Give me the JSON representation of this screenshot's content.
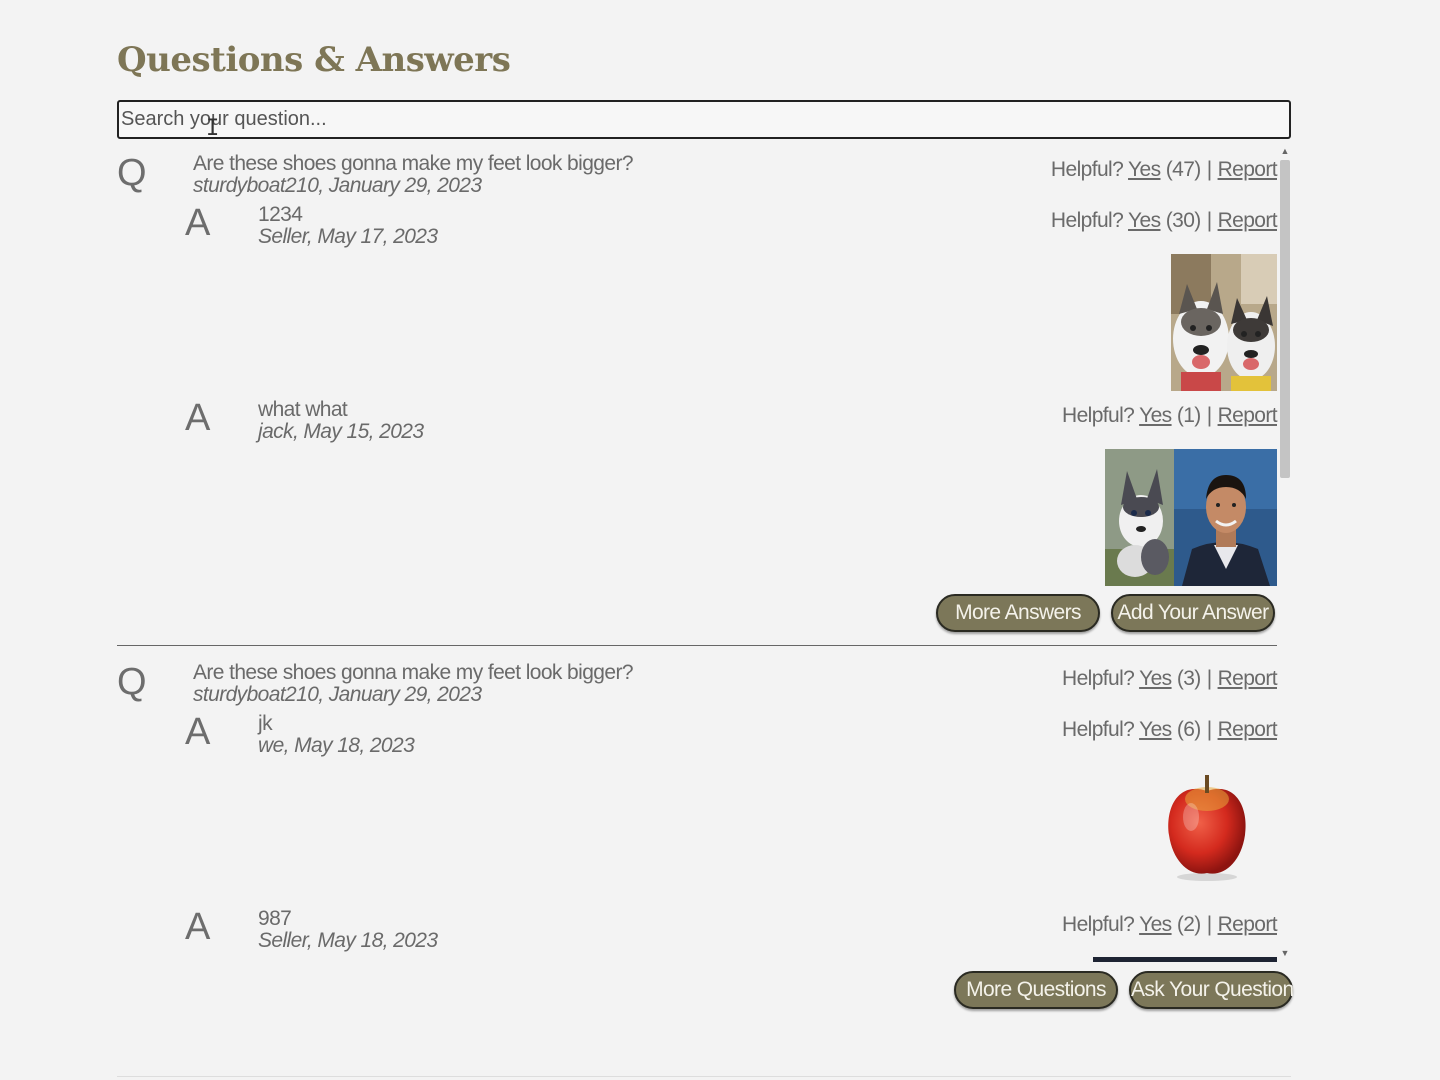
{
  "page": {
    "title": "Questions & Answers"
  },
  "search": {
    "placeholder": "Search your question..."
  },
  "questions": [
    {
      "letter": "Q",
      "text": "Are these shoes gonna make my feet look bigger?",
      "meta": "sturdyboat210, January 29, 2023",
      "helpful_label": "Helpful?",
      "yes_label": "Yes",
      "yes_count": "(47)",
      "report_label": "Report",
      "answers": [
        {
          "letter": "A",
          "text": "1234",
          "meta": "Seller, May 17, 2023",
          "helpful_label": "Helpful?",
          "yes_label": "Yes",
          "yes_count": "(30)",
          "report_label": "Report",
          "photos": [
            "two-huskies-photo"
          ]
        },
        {
          "letter": "A",
          "text": "what what",
          "meta": "jack, May 15, 2023",
          "helpful_label": "Helpful?",
          "yes_label": "Yes",
          "yes_count": "(1)",
          "report_label": "Report",
          "photos": [
            "husky-puppy-photo",
            "man-portrait-photo"
          ]
        }
      ],
      "more_answers_label": "More Answers",
      "add_answer_label": "Add Your Answer"
    },
    {
      "letter": "Q",
      "text": "Are these shoes gonna make my feet look bigger?",
      "meta": "sturdyboat210, January 29, 2023",
      "helpful_label": "Helpful?",
      "yes_label": "Yes",
      "yes_count": "(3)",
      "report_label": "Report",
      "answers": [
        {
          "letter": "A",
          "text": "jk",
          "meta": "we, May 18, 2023",
          "helpful_label": "Helpful?",
          "yes_label": "Yes",
          "yes_count": "(6)",
          "report_label": "Report",
          "photos": [
            "red-apple-photo"
          ]
        },
        {
          "letter": "A",
          "text": "987",
          "meta": "Seller, May 18, 2023",
          "helpful_label": "Helpful?",
          "yes_label": "Yes",
          "yes_count": "(2)",
          "report_label": "Report",
          "photos": []
        }
      ]
    }
  ],
  "footer_buttons": {
    "more_questions_label": "More Questions",
    "ask_question_label": "Ask Your Question"
  },
  "colors": {
    "accent": "#7c7759",
    "title": "#7e7656",
    "text": "#6a6a6a"
  }
}
